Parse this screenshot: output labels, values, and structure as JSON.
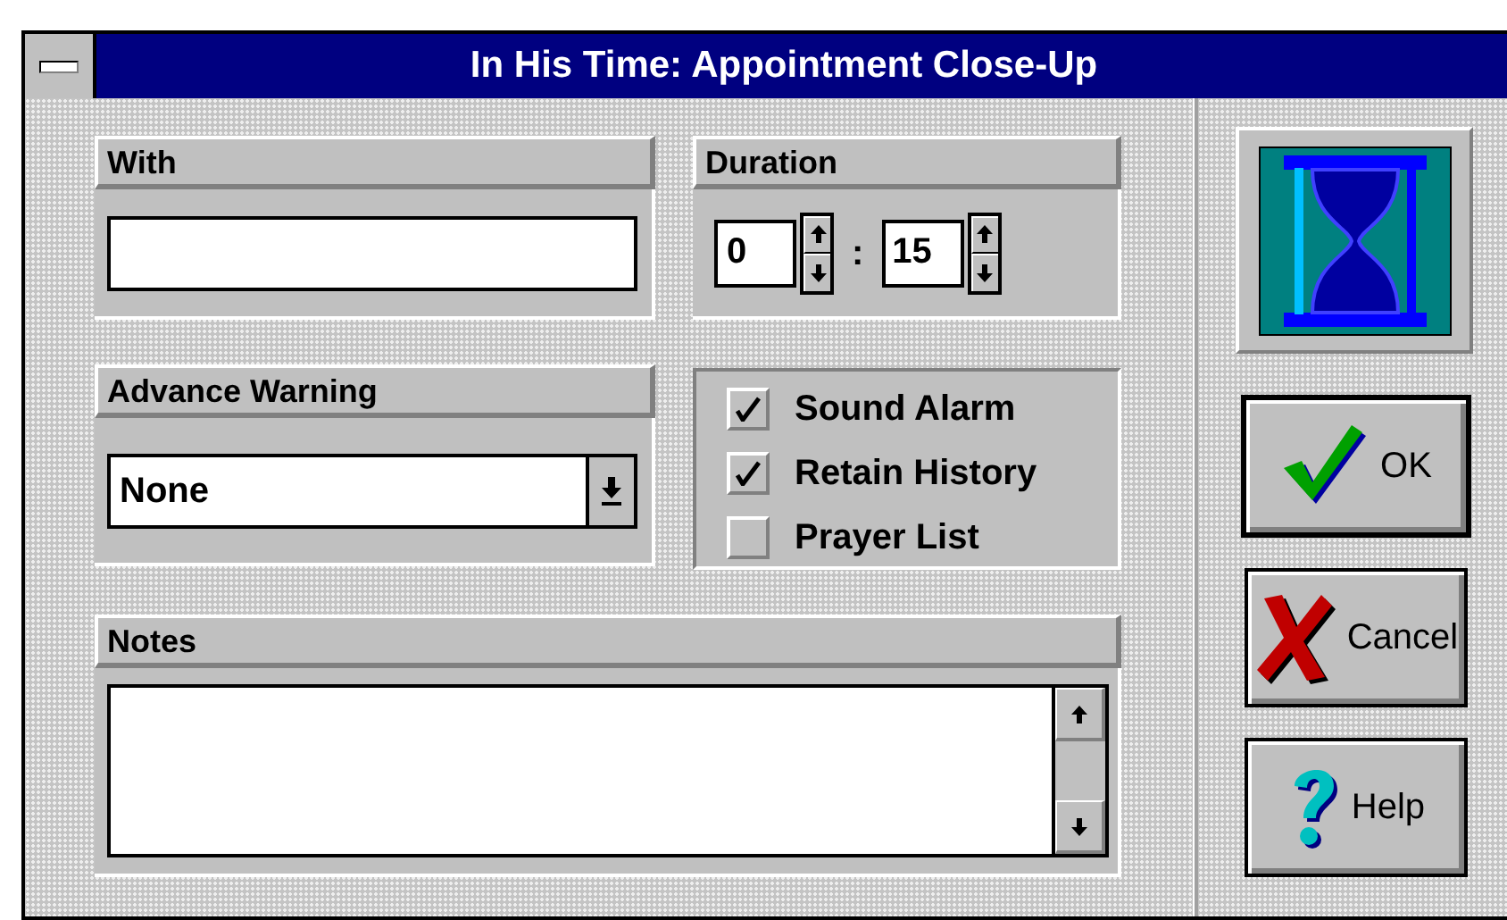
{
  "window": {
    "title": "In His Time: Appointment Close-Up"
  },
  "with": {
    "label": "With"
  },
  "duration": {
    "label": "Duration",
    "hours": "0",
    "separator": ":",
    "minutes": "15"
  },
  "advance_warning": {
    "label": "Advance Warning",
    "value": "None"
  },
  "options": [
    {
      "label": "Sound Alarm",
      "checked": true
    },
    {
      "label": "Retain History",
      "checked": true
    },
    {
      "label": "Prayer List",
      "checked": false
    }
  ],
  "notes": {
    "label": "Notes"
  },
  "buttons": [
    {
      "label": "OK",
      "kind": "ok",
      "default": true
    },
    {
      "label": "Cancel",
      "kind": "cancel",
      "default": false
    },
    {
      "label": "Help",
      "kind": "help",
      "default": false
    }
  ]
}
